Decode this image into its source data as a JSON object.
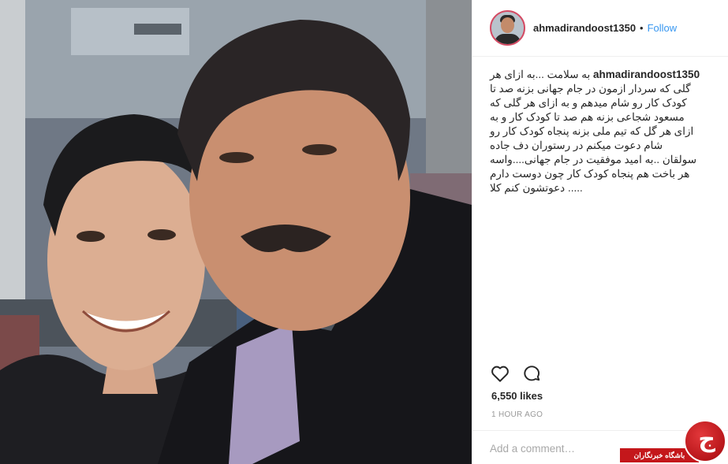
{
  "post": {
    "username": "ahmadirandoost1350",
    "separator": "•",
    "follow_label": "Follow",
    "caption_lines": [
      "به سلامت ...به ازای هر",
      "گلی که سردار ازمون در جام جهانی بزنه صد تا",
      "کودک کار رو شام میدهم و به ازای هر گلی که",
      "مسعود شجاعی بزنه هم صد تا کودک کار و به",
      "ازای هر گل که تیم ملی بزنه پنجاه کودک کار رو",
      "شام دعوت میکنم در رستوران دف جاده",
      "سولقان ..به امید موفقیت در جام جهانی....واسه",
      "هر باخت هم پنجاه کودک کار چون دوست دارم",
      "..... دعوتشون کنم کلا"
    ],
    "likes": "6,550 likes",
    "time": "1 HOUR AGO",
    "comment_placeholder": "Add a comment…"
  },
  "icons": {
    "like": "heart-icon",
    "comment": "comment-bubble-icon"
  },
  "watermark": {
    "text": "باشگاه خبرنگاران",
    "glyph": "ج"
  },
  "colors": {
    "follow": "#3897f0",
    "avatar_ring": "#d44a63",
    "watermark_red": "#c4171b",
    "timestamp": "#999999"
  }
}
